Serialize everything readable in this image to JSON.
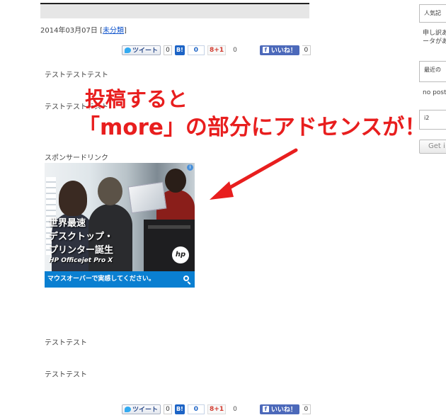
{
  "post": {
    "date": "2014年03月07日",
    "category_open": "[",
    "category": "未分類",
    "category_close": "]",
    "paragraphs": [
      "テストテストテスト",
      "テストテストテスト",
      "テストテスト",
      "テストテスト"
    ],
    "sponsored_label": "スポンサードリンク"
  },
  "share": {
    "tweet": "ツイート",
    "tweet_count": "0",
    "hatena": "B!",
    "hatena_count": "0",
    "gplus": "8+1",
    "gplus_count": "0",
    "facebook_like": "いいね！",
    "facebook_count": "0"
  },
  "ad": {
    "copy_line1": "世界最速",
    "copy_line2": "デスクトップ・",
    "copy_line3": "プリンター誕生",
    "model": "HP Officejet Pro X",
    "logo": "hp",
    "cta": "マウスオーバーで実感してください。",
    "info_icon": "i"
  },
  "annotation": {
    "line1": "投稿すると",
    "line2": "「more」の部分にアドセンスが！",
    "color": "#e81e1e"
  },
  "sidebar": {
    "widget1_title": "人気記",
    "widget1_text1": "申し訳あ",
    "widget1_text2": "ータがあ",
    "widget2_title": "最近の",
    "widget2_text": "no post",
    "widget3_value": "i2",
    "get_button": "Get i"
  },
  "icons": [
    "twitter-bird-icon",
    "hatena-bookmark-icon",
    "google-plus-icon",
    "facebook-like-icon",
    "magnifier-icon",
    "info-icon",
    "red-arrow-icon"
  ]
}
